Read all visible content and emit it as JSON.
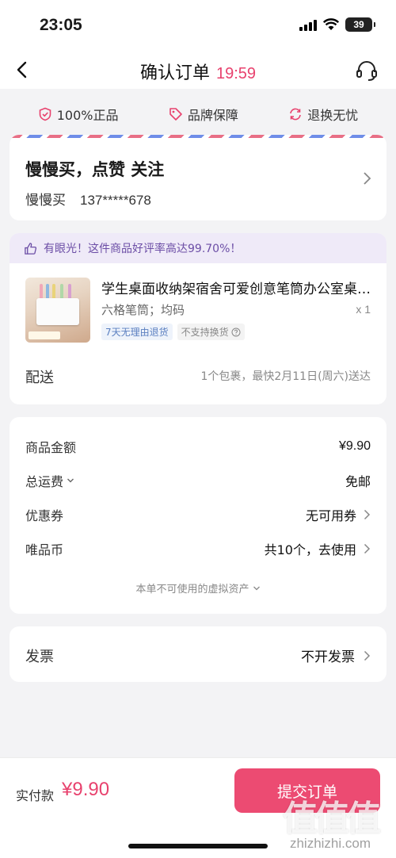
{
  "status": {
    "time": "23:05",
    "battery": "39"
  },
  "nav": {
    "title": "确认订单",
    "timer": "19:59"
  },
  "guarantees": [
    {
      "label": "100%正品",
      "icon": "shield-check-icon"
    },
    {
      "label": "品牌保障",
      "icon": "tag-icon"
    },
    {
      "label": "退换无忧",
      "icon": "refresh-icon"
    }
  ],
  "address": {
    "name_line": "慢慢买，点赞 关注",
    "receiver": "慢慢买",
    "phone": "137*****678"
  },
  "product": {
    "praise": "有眼光！这件商品好评率高达99.70%！",
    "title": "学生桌面收纳架宿舍可爱创意笔筒办公室桌上置物架",
    "spec": "六格笔筒；均码",
    "qty": "x 1",
    "tags": [
      "7天无理由退货",
      "不支持换货"
    ],
    "delivery_label": "配送",
    "delivery_info": "1个包裹，最快2月11日(周六)送达"
  },
  "pricing": {
    "rows": [
      {
        "label": "商品金额",
        "value": "¥9.90"
      },
      {
        "label": "总运费",
        "value": "免邮"
      },
      {
        "label": "优惠券",
        "value": "无可用券"
      },
      {
        "label": "唯品币",
        "value": "共10个，去使用"
      }
    ],
    "virtual_note": "本单不可使用的虚拟资产"
  },
  "invoice": {
    "label": "发票",
    "value": "不开发票"
  },
  "bottom": {
    "pay_label": "实付款",
    "pay_amount": "¥9.90",
    "submit": "提交订单"
  },
  "watermark": {
    "logo": "值值值",
    "text": "zhizhizhi.com"
  },
  "colors": {
    "accent": "#e8426e",
    "button": "#ec4b72",
    "praise": "#6c4ea6"
  }
}
